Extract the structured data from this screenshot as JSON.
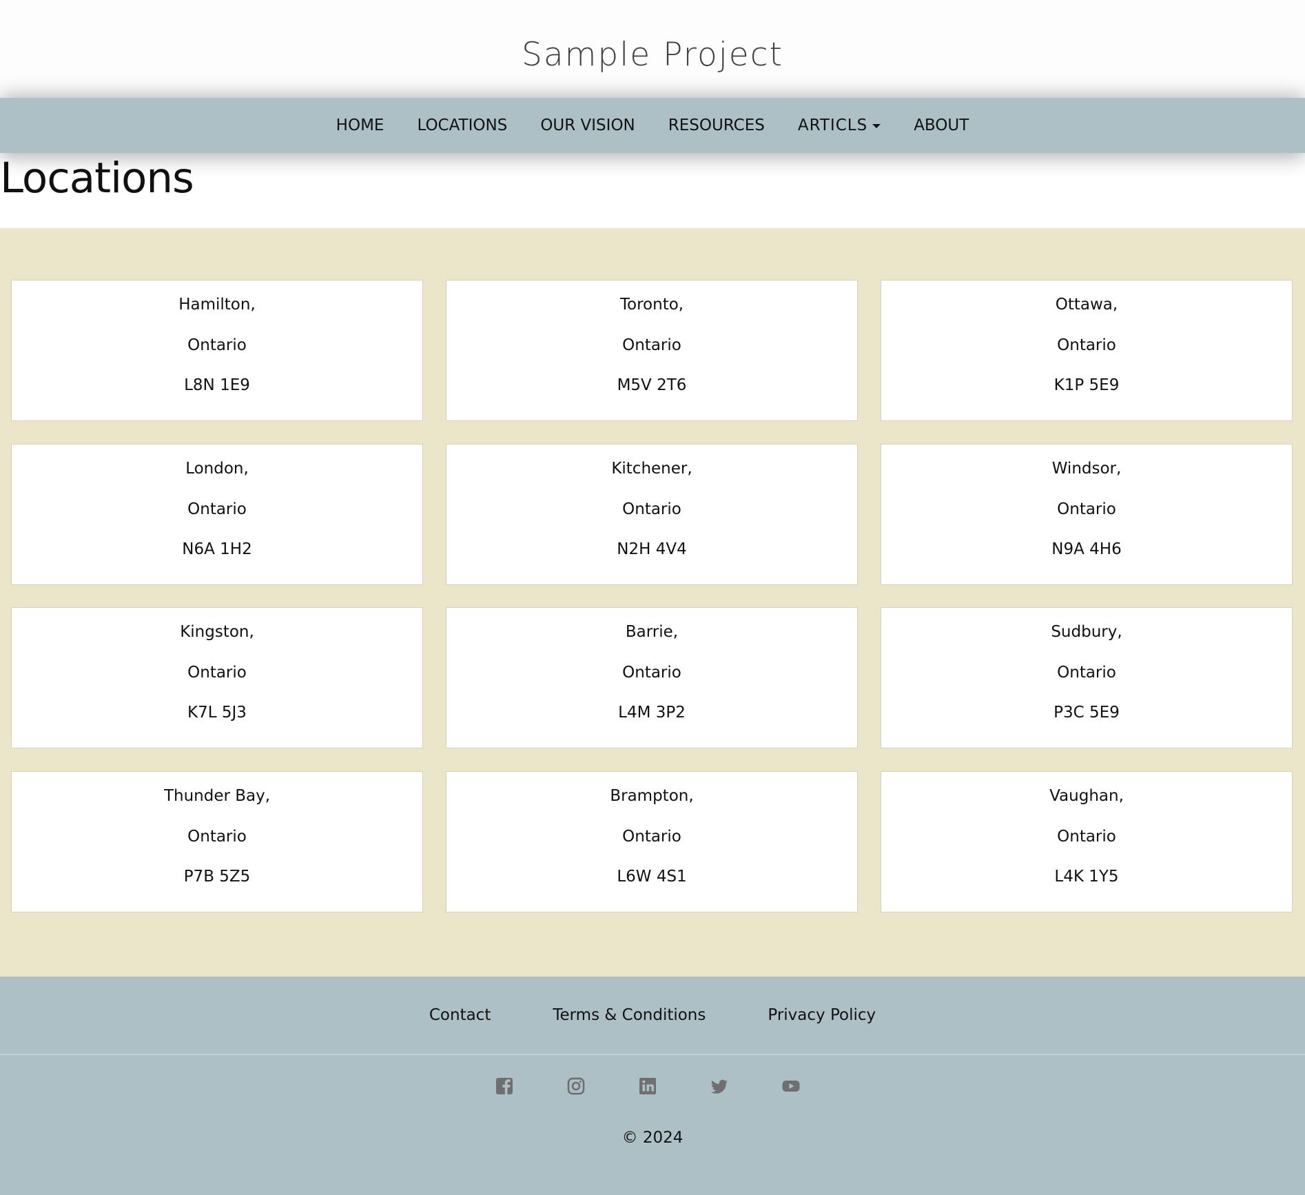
{
  "site": {
    "title": "Sample Project"
  },
  "nav": {
    "items": [
      {
        "label": "HOME"
      },
      {
        "label": "LOCATIONS"
      },
      {
        "label": "OUR VISION"
      },
      {
        "label": "RESOURCES"
      },
      {
        "label": "ARTICLS",
        "has_dropdown": true
      },
      {
        "label": "ABOUT"
      }
    ]
  },
  "page": {
    "heading": "Locations"
  },
  "locations": [
    {
      "city": "Hamilton,",
      "province": "Ontario",
      "postal": "L8N 1E9"
    },
    {
      "city": "Toronto,",
      "province": "Ontario",
      "postal": "M5V 2T6"
    },
    {
      "city": "Ottawa,",
      "province": "Ontario",
      "postal": "K1P 5E9"
    },
    {
      "city": "London,",
      "province": "Ontario",
      "postal": "N6A 1H2"
    },
    {
      "city": "Kitchener,",
      "province": "Ontario",
      "postal": "N2H 4V4"
    },
    {
      "city": "Windsor,",
      "province": "Ontario",
      "postal": "N9A 4H6"
    },
    {
      "city": "Kingston,",
      "province": "Ontario",
      "postal": "K7L 5J3"
    },
    {
      "city": "Barrie,",
      "province": "Ontario",
      "postal": "L4M 3P2"
    },
    {
      "city": "Sudbury,",
      "province": "Ontario",
      "postal": "P3C 5E9"
    },
    {
      "city": "Thunder Bay,",
      "province": "Ontario",
      "postal": "P7B 5Z5"
    },
    {
      "city": "Brampton,",
      "province": "Ontario",
      "postal": "L6W 4S1"
    },
    {
      "city": "Vaughan,",
      "province": "Ontario",
      "postal": "L4K 1Y5"
    }
  ],
  "footer": {
    "links": [
      {
        "label": "Contact"
      },
      {
        "label": "Terms & Conditions"
      },
      {
        "label": "Privacy Policy"
      }
    ],
    "social_icons": [
      "facebook-icon",
      "instagram-icon",
      "linkedin-icon",
      "twitter-icon",
      "youtube-icon"
    ],
    "copyright": "© 2024"
  },
  "colors": {
    "nav_bg": "#adc0c6",
    "section_bg": "#ebe5ca",
    "card_bg": "#ffffff",
    "icon_color": "#6f6f6f"
  }
}
